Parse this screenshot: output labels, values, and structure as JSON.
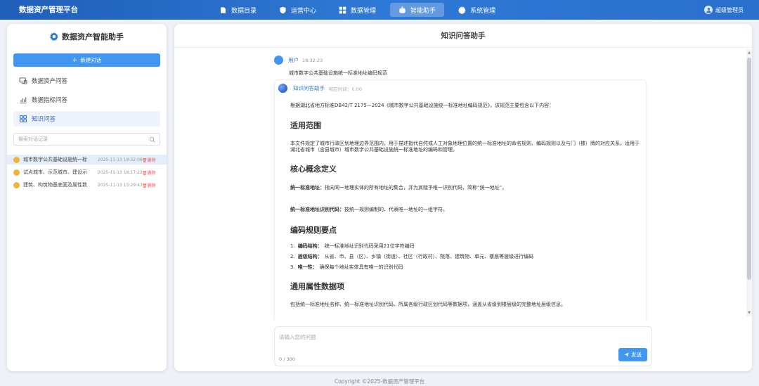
{
  "app": {
    "title": "数据资产管理平台"
  },
  "nav": {
    "items": [
      {
        "label": "数据目录",
        "icon": "catalog-icon"
      },
      {
        "label": "运营中心",
        "icon": "shield-icon"
      },
      {
        "label": "数据管理",
        "icon": "grid-icon"
      },
      {
        "label": "智能助手",
        "icon": "robot-icon",
        "active": true
      },
      {
        "label": "系统管理",
        "icon": "gear-icon"
      }
    ]
  },
  "user": {
    "name": "超级管理员"
  },
  "sidebar": {
    "title": "数据资产智能助手",
    "new_chat": "新建对话",
    "menu": [
      {
        "label": "数据资产问答"
      },
      {
        "label": "数据指标问答"
      },
      {
        "label": "知识问答",
        "active": true
      }
    ],
    "search_placeholder": "搜索对话记录",
    "history": [
      {
        "title": "城市数字公共基础设施统一标",
        "time": "2025-11-13 18:32:06",
        "delete": "删除"
      },
      {
        "title": "试点城市、示范城市、建设示",
        "time": "2025-11-13 18:17:22",
        "delete": "删除"
      },
      {
        "title": "建筑、构筑物基底面及属性数",
        "time": "2025-11-13 15:29:43",
        "delete": "删除"
      }
    ]
  },
  "main": {
    "title": "知识问答助手",
    "user_msg": {
      "name": "用户",
      "time": "18:32:23",
      "text": "城市数字公共基础设施统一标准地址编码规范"
    },
    "ai_msg": {
      "name": "知识问答助手",
      "time": "响应时间：0.00",
      "intro": "根据湖北省地方标准DB42/T 2175—2024《城市数字公共基础设施统一标准地址编码规范》，该规范主要包含以下内容：",
      "h1": "适用范围",
      "p1": "本文件规定了城市行政区划地理边界范围内，用于描述指代自然或人工对象地理位置的统一标准地址的命名规则、编码规则以及与门（楼）牌的对应关系。适用于湖北省城市（含县城市）城市数字公共基础设施统一标准地址的编码和管理。",
      "h2": "核心概念定义",
      "d1_term": "统一标准地址：",
      "d1_text": "指向同一地理实体的所有地址的集合，并为其赋予唯一识别代码，简称“统一地址”。",
      "d2_term": "统一标准地址识别代码：",
      "d2_text": "按统一规则编制的、代表唯一地址的一组字符。",
      "h3": "编码规则要点",
      "rules": [
        {
          "n": "1.",
          "term": "编码结构：",
          "text": "统一标准地址识别代码采用21位字符编码"
        },
        {
          "n": "2.",
          "term": "层级结构：",
          "text": "从省、市、县（区）、乡镇（街道）、社区（行政村）、院落、建筑物、单元、楼层等层级进行编码"
        },
        {
          "n": "3.",
          "term": "唯一性：",
          "text": "确保每个地址实体具有唯一的识别代码"
        }
      ],
      "h4": "通用属性数据项",
      "p4": "包括统一标准地址名称、统一标准地址识别代码、所属各级行政区划代码等数据项，涵盖从省级到楼层级的完整地址层级信息。"
    },
    "input_placeholder": "请输入您的问题",
    "counter": "0 / 300",
    "send": "发送"
  },
  "footer": "Copyright ©2025-数据资产管理平台"
}
